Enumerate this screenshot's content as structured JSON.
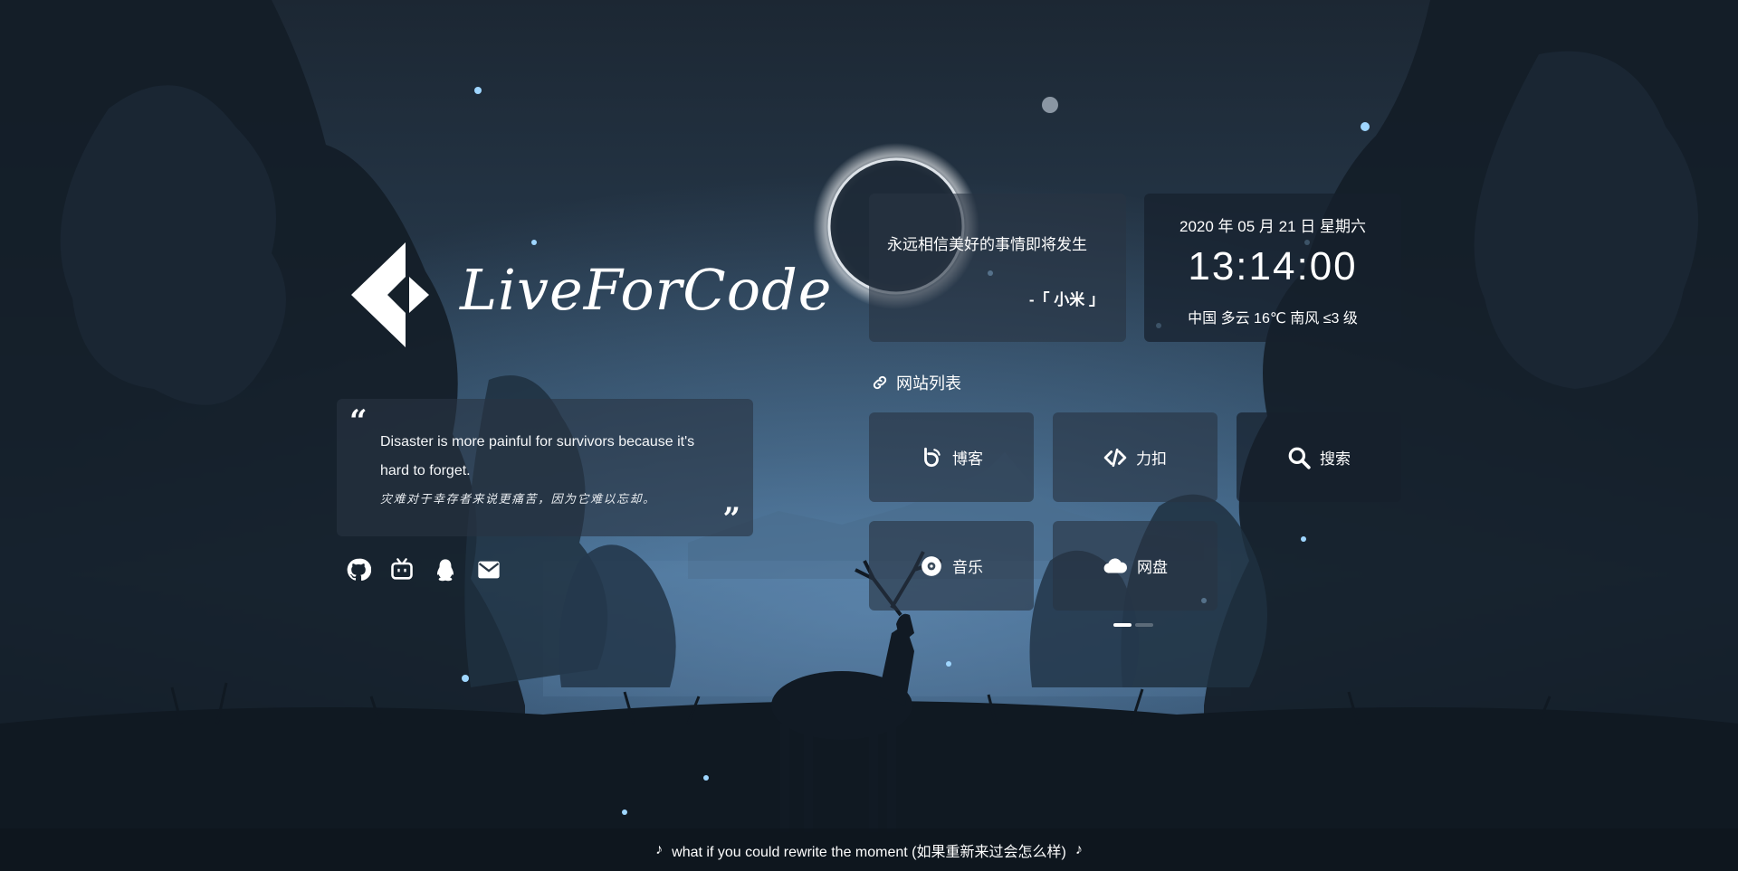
{
  "logo": {
    "text": "LiveForCode"
  },
  "quote": {
    "open_mark": "“",
    "close_mark": "”",
    "english": "Disaster is more painful for survivors because it's hard to forget.",
    "chinese": "灾难对于幸存者来说更痛苦，因为它难以忘却。"
  },
  "social": [
    "github-icon",
    "bilibili-icon",
    "qq-icon",
    "mail-icon"
  ],
  "hitokoto": {
    "text": "永远相信美好的事情即将发生",
    "from": "-「 小米 」"
  },
  "time": {
    "date": "2020 年 05 月 21 日 星期六",
    "clock": "13:14:00",
    "weather": "中国 多云 16℃ 南风 ≤3 级"
  },
  "site_list": {
    "title": "网站列表",
    "items": [
      {
        "label": "博客",
        "icon": "blog-icon"
      },
      {
        "label": "力扣",
        "icon": "code-icon"
      },
      {
        "label": "搜索",
        "icon": "search-icon"
      },
      {
        "label": "音乐",
        "icon": "music-icon"
      },
      {
        "label": "网盘",
        "icon": "cloud-icon"
      }
    ],
    "pages": 2,
    "current_page": 1
  },
  "footer": {
    "song": "what if you could rewrite the moment (如果重新来过会怎么样)"
  },
  "colors": {
    "accent": "#ffffff",
    "panel": "#28343f",
    "background": "#243546"
  }
}
